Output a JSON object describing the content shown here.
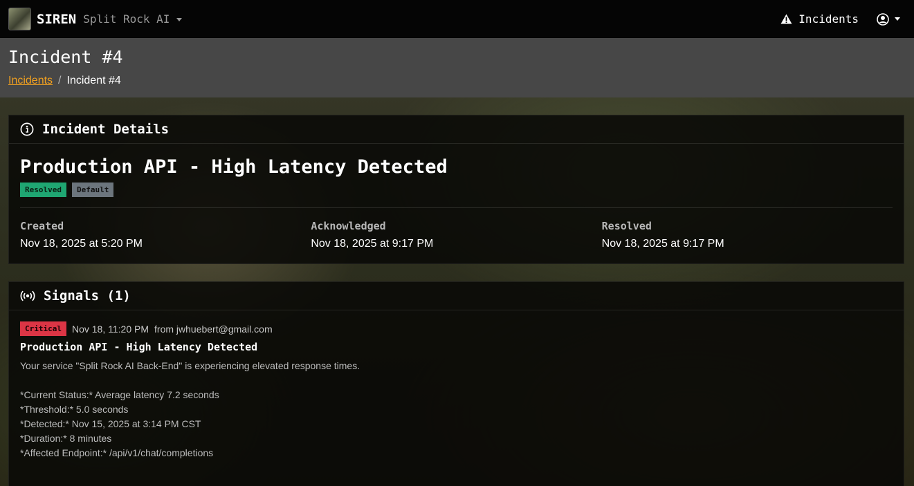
{
  "navbar": {
    "brand": "SIREN",
    "org": "Split Rock AI",
    "incidents_label": "Incidents"
  },
  "page": {
    "title": "Incident #4",
    "breadcrumb": {
      "root": "Incidents",
      "sep": "/",
      "current": "Incident #4"
    }
  },
  "details": {
    "header": "Incident Details",
    "title": "Production API - High Latency Detected",
    "badges": {
      "status": "Resolved",
      "priority": "Default"
    },
    "created_label": "Created",
    "created_value": "Nov 18, 2025 at 5:20 PM",
    "acknowledged_label": "Acknowledged",
    "acknowledged_value": "Nov 18, 2025 at 9:17 PM",
    "resolved_label": "Resolved",
    "resolved_value": "Nov 18, 2025 at 9:17 PM"
  },
  "signals": {
    "header": "Signals (1)",
    "items": [
      {
        "severity": "Critical",
        "time": "Nov 18, 11:20 PM",
        "from": "from jwhuebert@gmail.com",
        "title": "Production API - High Latency Detected",
        "description": "Your service \"Split Rock AI Back-End\" is experiencing elevated response times.",
        "lines": [
          "*Current Status:* Average latency 7.2 seconds",
          "*Threshold:* 5.0 seconds",
          "*Detected:* Nov 15, 2025 at 3:14 PM CST",
          "*Duration:* 8 minutes",
          "*Affected Endpoint:* /api/v1/chat/completions"
        ]
      }
    ]
  },
  "colors": {
    "accent": "#f0a020",
    "resolved": "#1fa672",
    "default": "#6c757d",
    "critical": "#dc3545"
  },
  "icons": {
    "warning": "warning-triangle-icon",
    "user": "user-circle-icon",
    "info": "info-circle-icon",
    "signals": "broadcast-icon"
  }
}
